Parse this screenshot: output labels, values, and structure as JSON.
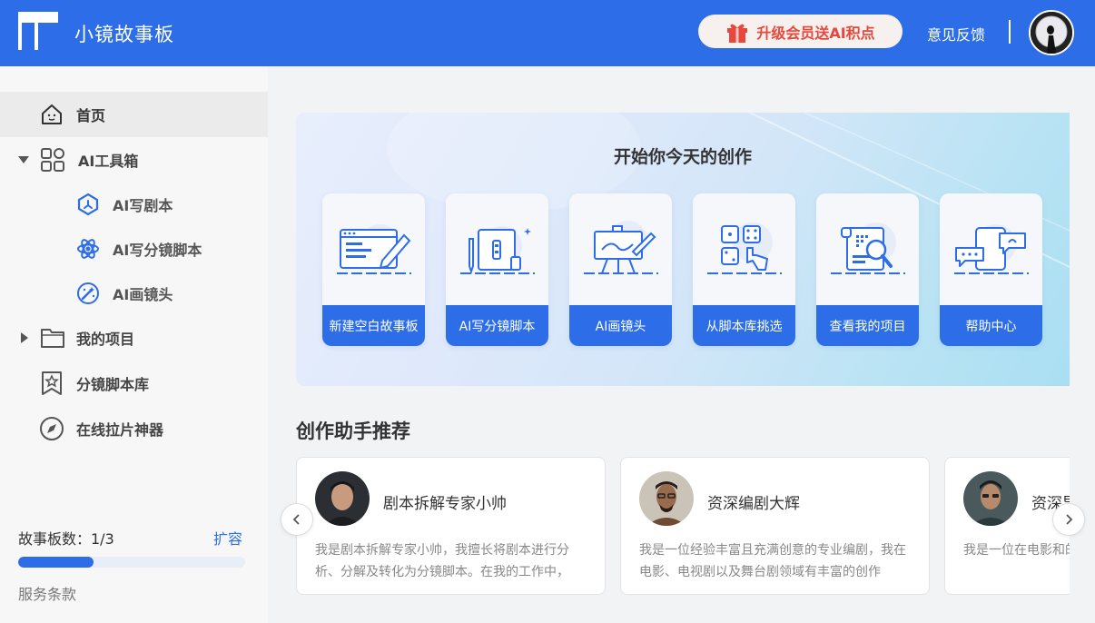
{
  "header": {
    "app_title": "小镜故事板",
    "upgrade_label": "升级会员送AI积点",
    "feedback_label": "意见反馈",
    "brand_color": "#2d6ee8",
    "upgrade_text_color": "#e8483c"
  },
  "sidebar": {
    "items": [
      {
        "label": "首页",
        "icon": "home-icon"
      },
      {
        "label": "AI工具箱",
        "icon": "apps-icon"
      },
      {
        "label": "AI写剧本",
        "icon": "script-icon"
      },
      {
        "label": "AI写分镜脚本",
        "icon": "atom-icon"
      },
      {
        "label": "AI画镜头",
        "icon": "magic-wand-icon"
      },
      {
        "label": "我的项目",
        "icon": "folder-icon"
      },
      {
        "label": "分镜脚本库",
        "icon": "bookmark-star-icon"
      },
      {
        "label": "在线拉片神器",
        "icon": "compass-icon"
      }
    ],
    "storyboard_count_label": "故事板数：1/3",
    "storyboard_used": 1,
    "storyboard_limit": 3,
    "expand_label": "扩容",
    "terms_label": "服务条款"
  },
  "banner": {
    "title": "开始你今天的创作",
    "actions": [
      {
        "label": "新建空白故事板",
        "icon": "browser-pen-icon"
      },
      {
        "label": "AI写分镜脚本",
        "icon": "scroll-pencil-icon"
      },
      {
        "label": "AI画镜头",
        "icon": "easel-icon"
      },
      {
        "label": "从脚本库挑选",
        "icon": "dice-hand-icon"
      },
      {
        "label": "查看我的项目",
        "icon": "document-magnifier-icon"
      },
      {
        "label": "帮助中心",
        "icon": "chat-bubbles-icon"
      }
    ]
  },
  "assistants": {
    "section_title": "创作助手推荐",
    "items": [
      {
        "name": "剧本拆解专家小帅",
        "desc": "我是剧本拆解专家小帅，我擅长将剧本进行分析、分解及转化为分镜脚本。在我的工作中，"
      },
      {
        "name": "资深编剧大辉",
        "desc": "我是一位经验丰富且充满创意的专业编剧，我在电影、电视剧以及舞台剧领域有丰富的创作"
      },
      {
        "name": "资深导",
        "desc": "我是一位在电影和的专业导演。我有"
      }
    ]
  }
}
